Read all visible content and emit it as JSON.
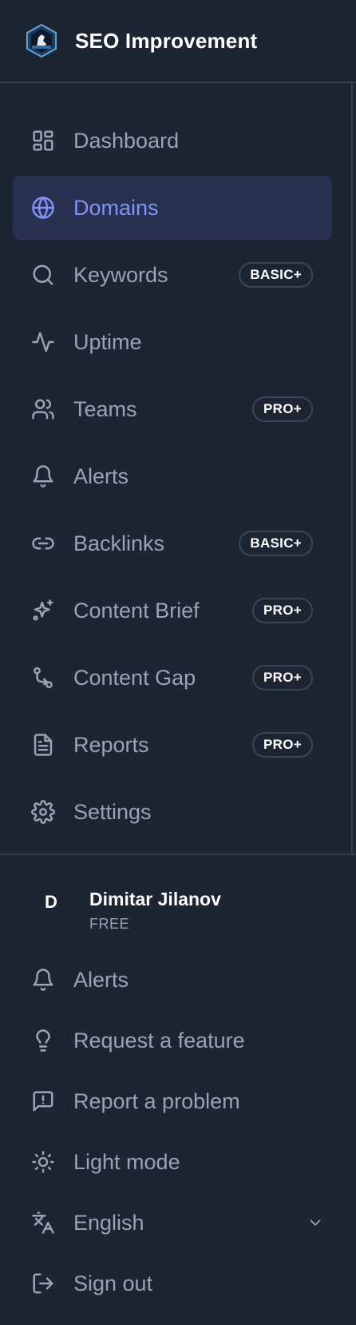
{
  "app": {
    "title": "SEO Improvement"
  },
  "nav": {
    "items": [
      {
        "label": "Dashboard",
        "icon": "dashboard-grid-icon",
        "badge": ""
      },
      {
        "label": "Domains",
        "icon": "globe-icon",
        "badge": "",
        "active": true
      },
      {
        "label": "Keywords",
        "icon": "search-icon",
        "badge": "BASIC+"
      },
      {
        "label": "Uptime",
        "icon": "activity-pulse-icon",
        "badge": ""
      },
      {
        "label": "Teams",
        "icon": "users-icon",
        "badge": "PRO+"
      },
      {
        "label": "Alerts",
        "icon": "bell-icon",
        "badge": ""
      },
      {
        "label": "Backlinks",
        "icon": "link-icon",
        "badge": "BASIC+"
      },
      {
        "label": "Content Brief",
        "icon": "sparkles-icon",
        "badge": "PRO+"
      },
      {
        "label": "Content Gap",
        "icon": "git-compare-icon",
        "badge": "PRO+"
      },
      {
        "label": "Reports",
        "icon": "file-text-icon",
        "badge": "PRO+"
      },
      {
        "label": "Settings",
        "icon": "gear-icon",
        "badge": ""
      }
    ]
  },
  "user": {
    "initial": "D",
    "name": "Dimitar Jilanov",
    "plan": "FREE"
  },
  "footer": {
    "alerts": "Alerts",
    "request_feature": "Request a feature",
    "report_problem": "Report a problem",
    "light_mode": "Light mode",
    "language": "English",
    "sign_out": "Sign out"
  },
  "colors": {
    "background": "#1e2532",
    "active_bg": "#283250",
    "accent": "#8193f7",
    "text_muted": "#97a3b6",
    "text_bright": "#ffffff",
    "border": "#343d4c"
  }
}
